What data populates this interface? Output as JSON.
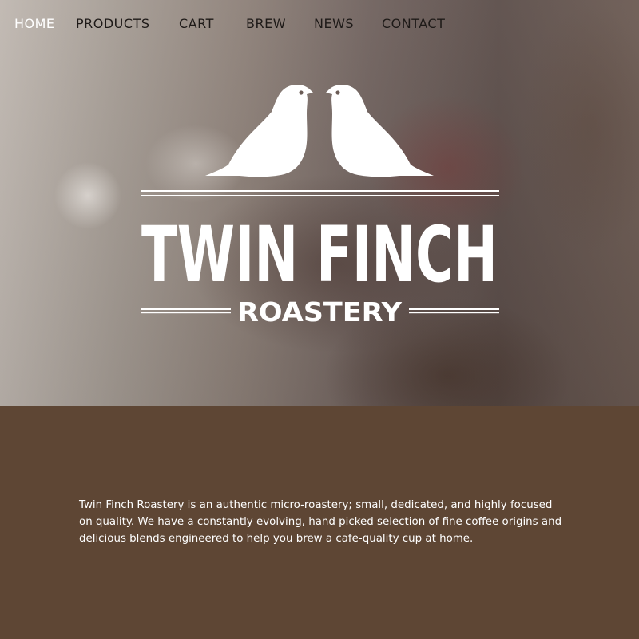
{
  "nav": {
    "items": [
      {
        "label": "HOME",
        "active": true
      },
      {
        "label": "PRODUCTS",
        "active": false
      },
      {
        "label": "CART",
        "active": false
      },
      {
        "label": "BREW",
        "active": false
      },
      {
        "label": "NEWS",
        "active": false
      },
      {
        "label": "CONTACT",
        "active": false
      }
    ]
  },
  "logo": {
    "name": "TWIN FINCH",
    "subtitle": "ROASTERY",
    "icon": "twin-finch-birds-icon",
    "color": "#ffffff"
  },
  "about": {
    "text": "Twin Finch Roastery is an authentic micro-roastery; small, dedicated, and highly focused on quality. We have a constantly evolving, hand picked selection of fine coffee origins and delicious blends engineered to help you brew a cafe-quality cup at home."
  },
  "colors": {
    "content_background": "#5e4634",
    "nav_text": "#1e1a18",
    "nav_active_text": "#ffffff",
    "body_text": "#ffffff"
  }
}
